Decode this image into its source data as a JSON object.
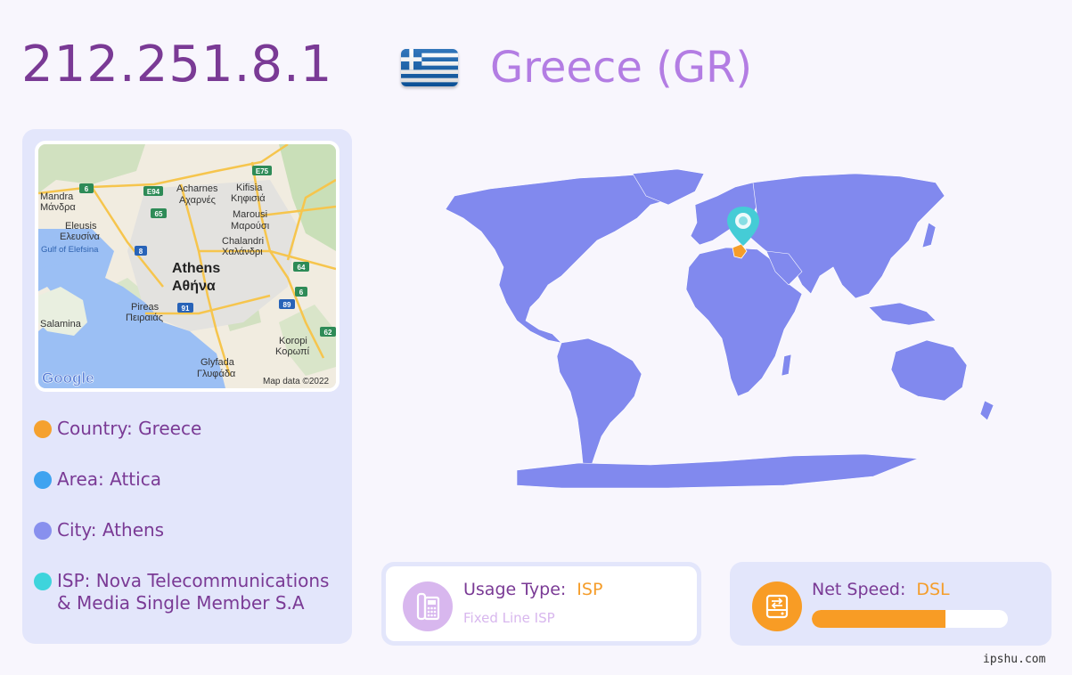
{
  "header": {
    "ip": "212.251.8.1",
    "country_title": "Greece (GR)"
  },
  "flag": {
    "icon": "greece-flag-icon",
    "colors": [
      "#0d5eaf",
      "#ffffff"
    ]
  },
  "mini_map": {
    "labels": {
      "mandra": "Mandra",
      "mandra_gr": "Μάνδρα",
      "eleusis": "Eleusis",
      "eleusis_gr": "Ελευσίνα",
      "gulf": "Gulf of Elefsina",
      "acharnes": "Acharnes",
      "acharnes_gr": "Αχαρνές",
      "kifisia": "Kifisia",
      "kifisia_gr": "Κηφισιά",
      "marousi": "Marousi",
      "marousi_gr": "Μαρούσι",
      "chalandri": "Chalandri",
      "chalandri_gr": "Χαλάνδρι",
      "athens": "Athens",
      "athens_gr": "Αθήνα",
      "pireas": "Pireas",
      "pireas_gr": "Πειραιάς",
      "salamina": "Salamina",
      "koropi": "Koropi",
      "koropi_gr": "Κορωπί",
      "glyfada": "Glyfada",
      "glyfada_gr": "Γλυφάδα",
      "google": "Google",
      "copyright": "Map data ©2022"
    },
    "road_shields": {
      "r6a": "6",
      "e94": "E94",
      "e75": "E75",
      "r65": "65",
      "r8": "8",
      "r64": "64",
      "r6b": "6",
      "r91": "91",
      "r89": "89",
      "r62": "62"
    }
  },
  "info": {
    "country": "Country: Greece",
    "area": "Area: Attica",
    "city": "City: Athens",
    "isp": "ISP: Nova Telecommunications & Media Single Member S.A",
    "dot_colors": {
      "country": "#f5a12f",
      "area": "#3fa3f0",
      "city": "#8890ee",
      "isp": "#3ed4dc"
    }
  },
  "world_map": {
    "land_color": "#8189ee",
    "marker_color": "#45ccd6",
    "highlight_color": "#f59d2a"
  },
  "usage": {
    "label": "Usage Type:",
    "value": "ISP",
    "sub": "Fixed Line ISP",
    "icon": "fax-phone-icon"
  },
  "speed": {
    "label": "Net Speed:",
    "value": "DSL",
    "fill_fraction": 0.68,
    "icon": "network-drive-icon"
  },
  "footer": {
    "site": "ipshu.com"
  },
  "colors": {
    "accent_purple": "#7a3a95",
    "title_lavender": "#b37de3",
    "orange": "#f59d2a",
    "panel": "#e3e6fb"
  }
}
